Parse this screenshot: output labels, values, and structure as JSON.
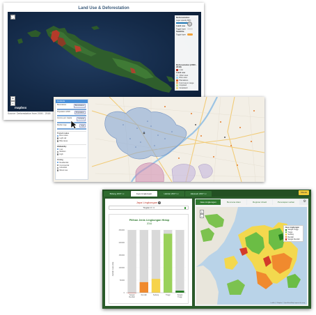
{
  "card1": {
    "title": "Land Use & Deforestation",
    "footer": "Source: Deforestation from 2000 - 2018",
    "attribution": "mapbox",
    "zoom_in": "+",
    "zoom_out": "−",
    "fullscreen_icon": "fullscreen-icon",
    "panel": {
      "deforestation_title": "Deforestation",
      "deforestation_sub": "Layer opacity 80%",
      "landuse_title": "Land use",
      "landuse_sub": "Toggle layer",
      "satellite_title": "Satellite",
      "satellite_sub": "Toggle layer",
      "deforestation_legend_title": "Deforestation (2000 - 2018)",
      "deforestation_item": "Loss",
      "landuse_legend_title": "Land use",
      "landuse_items": [
        {
          "label": "Other uses",
          "color": "#c9c9c9"
        },
        {
          "label": "Rice uses",
          "color": "#a3d7f2"
        },
        {
          "label": "Plantations",
          "color": "#e06b3c"
        },
        {
          "label": "Fund use in range",
          "color": "#f7a65b"
        },
        {
          "label": "Cropland",
          "color": "#c6e08e"
        },
        {
          "label": "Grassland",
          "color": "#f1d98c"
        }
      ]
    }
  },
  "card2": {
    "panel_title": "Controls",
    "rows": [
      {
        "label": "Boundaries",
        "value": "Boundaries"
      },
      {
        "label": "Population 2018",
        "value": "Population"
      },
      {
        "label": "Income per Capita",
        "value": "Income"
      },
      {
        "label": "Median Age",
        "value": "Age"
      }
    ],
    "section_transit": "Transit routes",
    "transit_options": [
      "Bus routes",
      "Light rail",
      "Bike lanes"
    ],
    "section_walk": "Walkability",
    "walk_options": [
      "Low",
      "Medium",
      "High"
    ],
    "section_zones": "Zoning",
    "zone_options": [
      "Residential",
      "Commercial",
      "Industrial",
      "Mixed use"
    ]
  },
  "card3": {
    "top_tabs": [
      "Bidang 2007 t.c",
      "Jaya Lingkungan",
      "Habitat 2007 t.c",
      "Jakaweb 2007 t.c"
    ],
    "active_top_tab": 1,
    "top_button": "Masuk",
    "left_header": "Jaya Lingkungan",
    "select_value": "Tingkat 3 / 4",
    "chart_title": "Pilihan Jenis Lingkungan Hidup",
    "chart_year": "2016",
    "right_tabs": [
      "Jasa Lingkungan",
      "Bencana Alam",
      "Register Abadi",
      "Penetapan Lahan"
    ],
    "active_right_tab": 0,
    "legend_title": "Jasa Lingkungan",
    "legend_items": [
      {
        "label": "Sangat Tinggi",
        "color": "#1f7a1f"
      },
      {
        "label": "Tinggi",
        "color": "#6cc04a"
      },
      {
        "label": "Sedang",
        "color": "#f6d34a"
      },
      {
        "label": "Rendah",
        "color": "#f08a2e"
      },
      {
        "label": "Sangat Rendah",
        "color": "#d33a2a"
      }
    ],
    "attribution": "Leaflet | © Mapbox © OpenStreetMap Improve this map",
    "zoom_in": "+",
    "zoom_out": "−"
  },
  "chart_data": {
    "type": "bar",
    "title": "Pilihan Jenis Lingkungan Hidup",
    "subtitle": "2016",
    "ylabel": "Jumlah Luas (Ha)",
    "categories": [
      "Sangat Rendah",
      "Rendah",
      "Sedang",
      "Tinggi",
      "Sangat Tinggi"
    ],
    "ytick_labels": [
      "250000",
      "200000",
      "150000",
      "100000",
      "50000",
      "0"
    ],
    "ylim": [
      0,
      250000
    ],
    "background_max": 250000,
    "values": [
      0,
      42000,
      55000,
      235000,
      8000
    ],
    "colors": [
      "#d33a2a",
      "#f08a2e",
      "#f6d34a",
      "#9ad15a",
      "#1f7a1f"
    ]
  }
}
